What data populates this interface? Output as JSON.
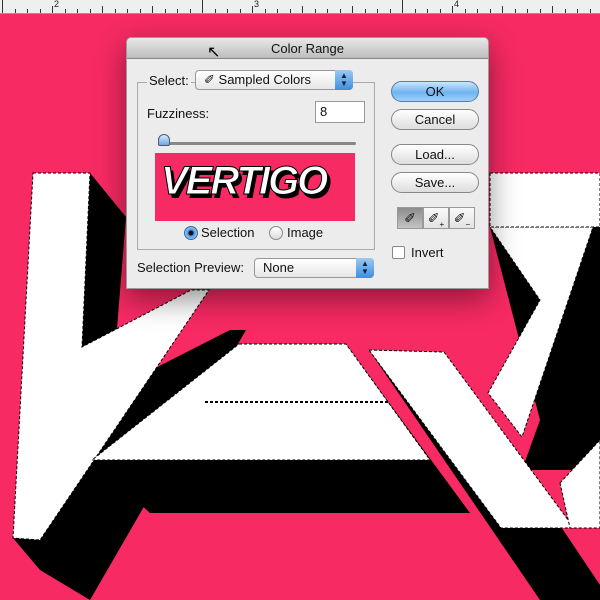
{
  "ruler": {
    "labels": [
      "2",
      "3",
      "4"
    ]
  },
  "dialog": {
    "title": "Color Range",
    "select_label": "Select:",
    "select_value": "Sampled Colors",
    "fuzziness_label": "Fuzziness:",
    "fuzziness_value": "8",
    "fuzziness_slider_fraction": 0.04,
    "preview_text": "VERTIGO",
    "radio_selection": "Selection",
    "radio_image": "Image",
    "radio_selected": "Selection",
    "selection_preview_label": "Selection Preview:",
    "selection_preview_value": "None",
    "buttons": {
      "ok": "OK",
      "cancel": "Cancel",
      "load": "Load...",
      "save": "Save..."
    },
    "invert_label": "Invert",
    "invert_checked": false
  },
  "colors": {
    "canvas": "#f72a63",
    "accent": "#4c97e8"
  }
}
